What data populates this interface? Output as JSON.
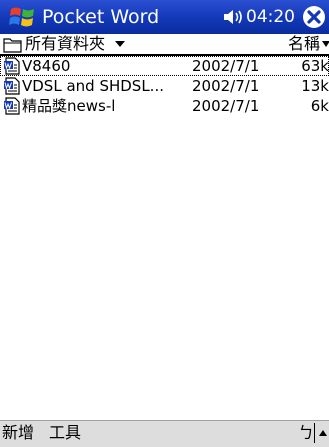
{
  "titlebar": {
    "app_title": "Pocket Word",
    "time": "04:20"
  },
  "folderbar": {
    "folder_label": "所有資料夾",
    "sort_label": "名稱"
  },
  "files": [
    {
      "name": "V8460",
      "date": "2002/7/1",
      "size": "63k"
    },
    {
      "name": "VDSL and SHDSL...",
      "date": "2002/7/1",
      "size": "13k"
    },
    {
      "name": "精品獎news-l",
      "date": "2002/7/1",
      "size": "6k"
    }
  ],
  "cmdbar": {
    "new_label": "新增",
    "tools_label": "工具",
    "ime_label": "ㄅ"
  },
  "colors": {
    "titlebar": "#1238b8",
    "cmdbar": "#dddddd"
  }
}
